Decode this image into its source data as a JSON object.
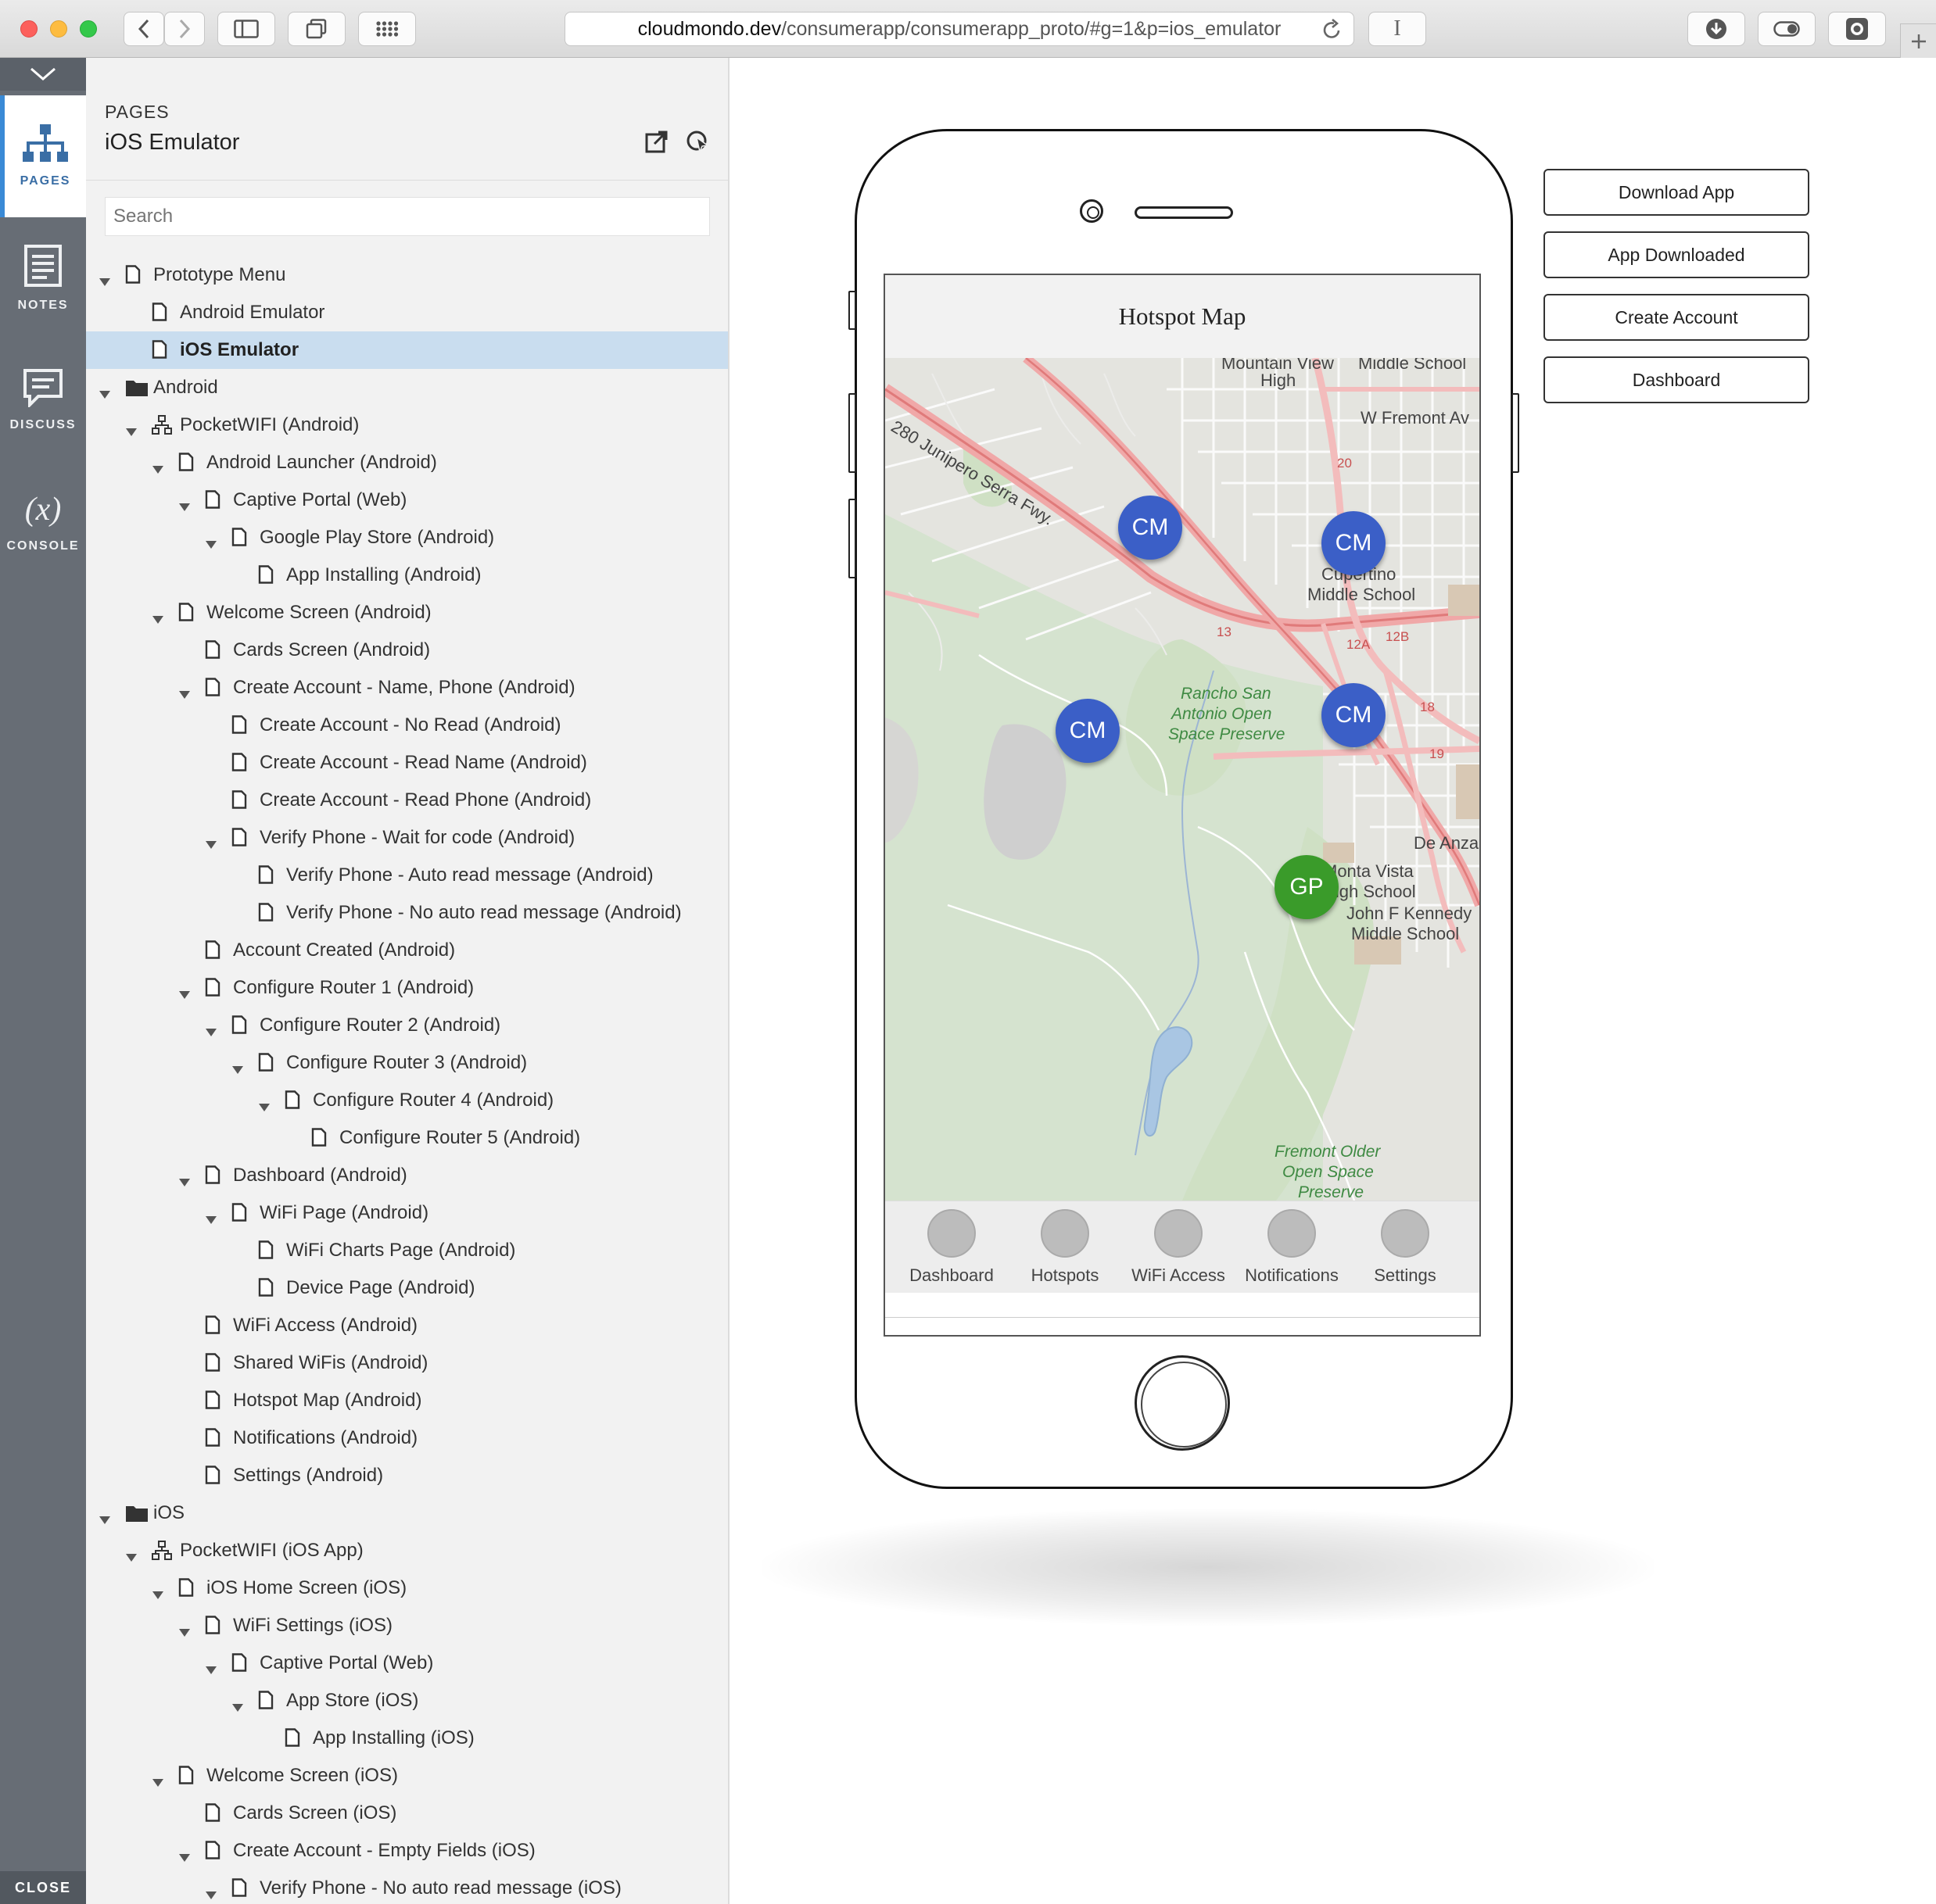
{
  "browser": {
    "url_host": "cloudmondo.dev",
    "url_path": "/consumerapp/consumerapp_proto/#g=1&p=ios_emulator",
    "reader_label": "I"
  },
  "rail": {
    "items": [
      {
        "label": "PAGES"
      },
      {
        "label": "NOTES"
      },
      {
        "label": "DISCUSS"
      },
      {
        "label": "CONSOLE"
      }
    ],
    "console_glyph": "(x)",
    "close_label": "CLOSE"
  },
  "panel": {
    "label": "PAGES",
    "title": "iOS Emulator",
    "search_placeholder": "Search"
  },
  "tree": [
    {
      "label": "Prototype Menu",
      "depth": 0,
      "icon": "page-icon",
      "expanded": true
    },
    {
      "label": "Android Emulator",
      "depth": 1,
      "icon": "page-icon"
    },
    {
      "label": "iOS Emulator",
      "depth": 1,
      "icon": "page-icon",
      "selected": true
    },
    {
      "label": "Android",
      "depth": 0,
      "icon": "folder-icon",
      "expanded": true
    },
    {
      "label": "PocketWIFI (Android)",
      "depth": 1,
      "icon": "flow-icon",
      "expanded": true
    },
    {
      "label": "Android Launcher (Android)",
      "depth": 2,
      "icon": "page-icon",
      "expanded": true
    },
    {
      "label": "Captive Portal (Web)",
      "depth": 3,
      "icon": "page-icon",
      "expanded": true
    },
    {
      "label": "Google Play Store (Android)",
      "depth": 4,
      "icon": "page-icon",
      "expanded": true
    },
    {
      "label": "App Installing (Android)",
      "depth": 5,
      "icon": "page-icon"
    },
    {
      "label": "Welcome Screen (Android)",
      "depth": 2,
      "icon": "page-icon",
      "expanded": true
    },
    {
      "label": "Cards Screen (Android)",
      "depth": 3,
      "icon": "page-icon"
    },
    {
      "label": "Create Account - Name, Phone (Android)",
      "depth": 3,
      "icon": "page-icon",
      "expanded": true
    },
    {
      "label": "Create Account - No Read (Android)",
      "depth": 4,
      "icon": "page-icon"
    },
    {
      "label": "Create Account - Read Name (Android)",
      "depth": 4,
      "icon": "page-icon"
    },
    {
      "label": "Create Account - Read Phone (Android)",
      "depth": 4,
      "icon": "page-icon"
    },
    {
      "label": "Verify Phone - Wait for code (Android)",
      "depth": 4,
      "icon": "page-icon",
      "expanded": true
    },
    {
      "label": "Verify Phone - Auto read message (Android)",
      "depth": 5,
      "icon": "page-icon"
    },
    {
      "label": "Verify Phone - No auto read message (Android)",
      "depth": 5,
      "icon": "page-icon"
    },
    {
      "label": "Account Created (Android)",
      "depth": 3,
      "icon": "page-icon"
    },
    {
      "label": "Configure Router 1 (Android)",
      "depth": 3,
      "icon": "page-icon",
      "expanded": true
    },
    {
      "label": "Configure Router 2 (Android)",
      "depth": 4,
      "icon": "page-icon",
      "expanded": true
    },
    {
      "label": "Configure Router 3 (Android)",
      "depth": 5,
      "icon": "page-icon",
      "expanded": true
    },
    {
      "label": "Configure Router 4 (Android)",
      "depth": 6,
      "icon": "page-icon",
      "expanded": true
    },
    {
      "label": "Configure Router 5 (Android)",
      "depth": 7,
      "icon": "page-icon"
    },
    {
      "label": "Dashboard (Android)",
      "depth": 3,
      "icon": "page-icon",
      "expanded": true
    },
    {
      "label": "WiFi Page (Android)",
      "depth": 4,
      "icon": "page-icon",
      "expanded": true
    },
    {
      "label": "WiFi Charts Page (Android)",
      "depth": 5,
      "icon": "page-icon"
    },
    {
      "label": "Device Page (Android)",
      "depth": 5,
      "icon": "page-icon"
    },
    {
      "label": "WiFi Access (Android)",
      "depth": 3,
      "icon": "page-icon"
    },
    {
      "label": "Shared WiFis (Android)",
      "depth": 3,
      "icon": "page-icon"
    },
    {
      "label": "Hotspot Map (Android)",
      "depth": 3,
      "icon": "page-icon"
    },
    {
      "label": "Notifications (Android)",
      "depth": 3,
      "icon": "page-icon"
    },
    {
      "label": "Settings (Android)",
      "depth": 3,
      "icon": "page-icon"
    },
    {
      "label": "iOS",
      "depth": 0,
      "icon": "folder-icon",
      "expanded": true
    },
    {
      "label": "PocketWIFI (iOS App)",
      "depth": 1,
      "icon": "flow-icon",
      "expanded": true
    },
    {
      "label": "iOS Home Screen (iOS)",
      "depth": 2,
      "icon": "page-icon",
      "expanded": true
    },
    {
      "label": "WiFi Settings (iOS)",
      "depth": 3,
      "icon": "page-icon",
      "expanded": true
    },
    {
      "label": "Captive Portal (Web)",
      "depth": 4,
      "icon": "page-icon",
      "expanded": true
    },
    {
      "label": "App Store (iOS)",
      "depth": 5,
      "icon": "page-icon",
      "expanded": true
    },
    {
      "label": "App Installing (iOS)",
      "depth": 6,
      "icon": "page-icon"
    },
    {
      "label": "Welcome Screen (iOS)",
      "depth": 2,
      "icon": "page-icon",
      "expanded": true
    },
    {
      "label": "Cards Screen (iOS)",
      "depth": 3,
      "icon": "page-icon"
    },
    {
      "label": "Create Account - Empty Fields (iOS)",
      "depth": 3,
      "icon": "page-icon",
      "expanded": true
    },
    {
      "label": "Verify Phone - No auto read message (iOS)",
      "depth": 4,
      "icon": "page-icon",
      "expanded": true
    }
  ],
  "phone": {
    "screen_title": "Hotspot Map",
    "markers": [
      "CM",
      "CM",
      "CM",
      "CM",
      "GP"
    ],
    "tabs": [
      "Dashboard",
      "Hotspots",
      "WiFi Access",
      "Notifications",
      "Settings"
    ],
    "map_labels": {
      "mv_high_1": "Mountain View",
      "mv_high_2": "High",
      "middle_school": "Middle School",
      "fremont_ave": "W Fremont Av",
      "freeway": "280 Junipero Serra Fwy.",
      "cupertino_1": "Cupertino",
      "cupertino_2": "Middle School",
      "rancho_1": "Rancho San",
      "rancho_2": "Antonio Open",
      "rancho_3": "Space Preserve",
      "de_anza": "De Anza",
      "monta_1": "Monta Vista",
      "monta_2": "High School",
      "jfk_1": "John F Kennedy",
      "jfk_2": "Middle School",
      "fremont_older_1": "Fremont Older",
      "fremont_older_2": "Open Space",
      "fremont_older_3": "Preserve",
      "r20": "20",
      "r13": "13",
      "r12a": "12A",
      "r12b": "12B",
      "r18": "18",
      "r19": "19"
    }
  },
  "actions": [
    "Download App",
    "App Downloaded",
    "Create Account",
    "Dashboard"
  ],
  "colors": {
    "marker_cm": "#3b5fc7",
    "marker_gp": "#3a9b2a",
    "selection": "#c9ddef",
    "rail": "#676d75"
  }
}
